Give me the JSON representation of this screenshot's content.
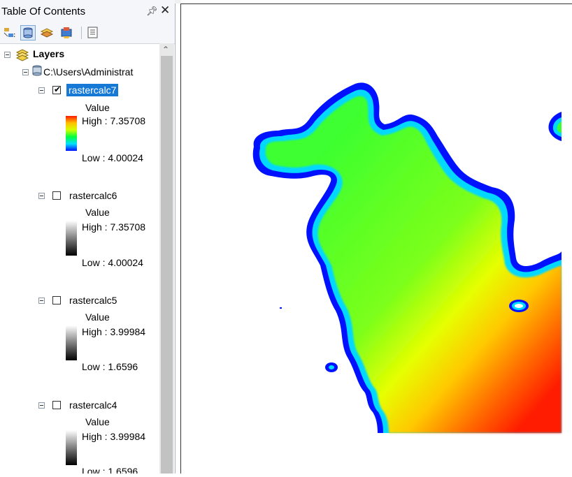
{
  "toc": {
    "title": "Table Of Contents",
    "pin_icon": "pin-icon",
    "close_icon": "close-icon",
    "toolbar": [
      {
        "icon": "list-by-drawing-order-icon"
      },
      {
        "icon": "list-by-source-icon",
        "active": true
      },
      {
        "icon": "list-by-visibility-icon"
      },
      {
        "icon": "list-by-selection-icon"
      },
      {
        "icon": "options-icon"
      }
    ],
    "tree": {
      "layers_label": "Layers",
      "source_path": "C:\\Users\\Administrat",
      "layers": [
        {
          "name": "rastercalc7",
          "checked": true,
          "selected": true,
          "value_label": "Value",
          "high": "High : 7.35708",
          "low": "Low : 4.00024",
          "ramp": "color"
        },
        {
          "name": "rastercalc6",
          "checked": false,
          "value_label": "Value",
          "high": "High : 7.35708",
          "low": "Low : 4.00024",
          "ramp": "gray"
        },
        {
          "name": "rastercalc5",
          "checked": false,
          "value_label": "Value",
          "high": "High : 3.99984",
          "low": "Low : 1.6596",
          "ramp": "gray"
        },
        {
          "name": "rastercalc4",
          "checked": false,
          "value_label": "Value",
          "high": "High : 3.99984",
          "low": "Low : 1.6596",
          "ramp": "gray"
        }
      ]
    }
  },
  "map": {
    "raster_colors": [
      "#0011ff",
      "#00e0ff",
      "#00ff40",
      "#a8ff00",
      "#ffff00",
      "#ff9900",
      "#ff1a00"
    ]
  }
}
